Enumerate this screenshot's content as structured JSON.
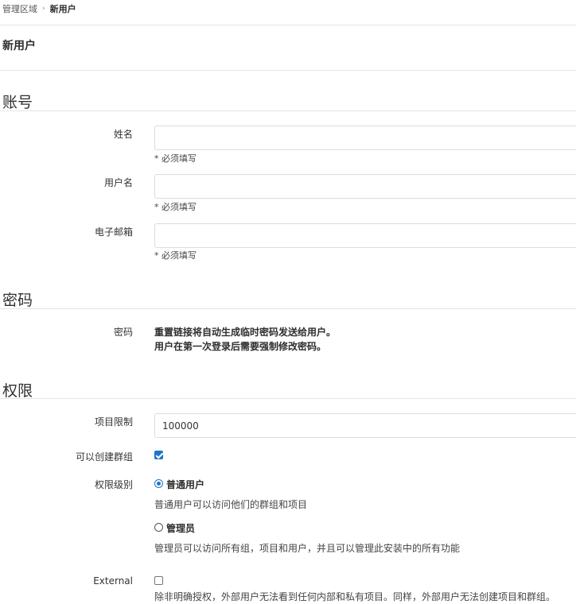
{
  "breadcrumb": {
    "parent": "管理区域",
    "current": "新用户"
  },
  "page_title": "新用户",
  "account": {
    "title": "账号",
    "name_label": "姓名",
    "name_value": "",
    "name_help": "* 必须填写",
    "username_label": "用户名",
    "username_value": "",
    "username_help": "* 必须填写",
    "email_label": "电子邮箱",
    "email_value": "",
    "email_help": "* 必须填写"
  },
  "password": {
    "title": "密码",
    "label": "密码",
    "line1": "重置链接将自动生成临时密码发送给用户。",
    "line2": "用户在第一次登录后需要强制修改密码。"
  },
  "permissions": {
    "title": "权限",
    "project_limit_label": "项目限制",
    "project_limit_value": "100000",
    "can_create_group_label": "可以创建群组",
    "can_create_group_checked": true,
    "access_level_label": "权限级别",
    "regular_label": "普通用户",
    "regular_help": "普通用户可以访问他们的群组和项目",
    "regular_selected": true,
    "admin_label": "管理员",
    "admin_help": "管理员可以访问所有组，项目和用户，并且可以管理此安装中的所有功能",
    "admin_selected": false,
    "external_label": "External",
    "external_checked": false,
    "external_help": "除非明确授权，外部用户无法看到任何内部和私有项目。同样，外部用户无法创建项目和群组。"
  }
}
